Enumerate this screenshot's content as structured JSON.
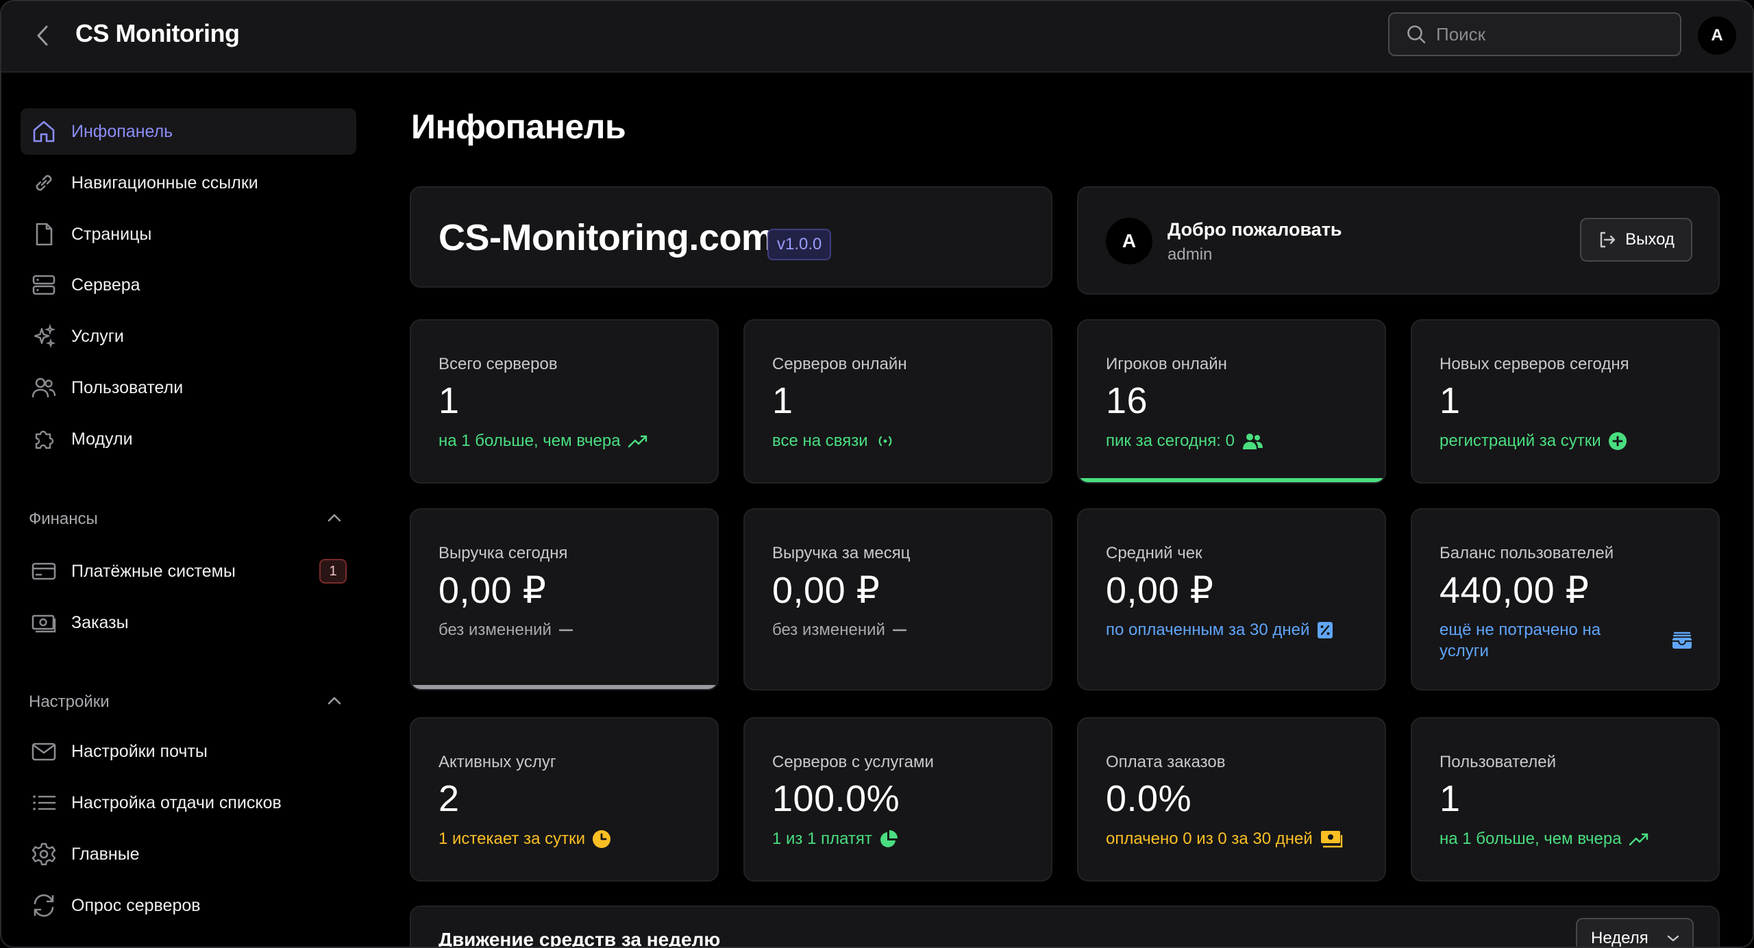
{
  "header": {
    "title": "CS Monitoring",
    "search_placeholder": "Поиск",
    "avatar": "A"
  },
  "sidebar": {
    "items": [
      {
        "label": "Инфопанель",
        "icon": "home-icon",
        "active": true
      },
      {
        "label": "Навигационные ссылки",
        "icon": "link-icon"
      },
      {
        "label": "Страницы",
        "icon": "file-icon"
      },
      {
        "label": "Сервера",
        "icon": "server-icon"
      },
      {
        "label": "Услуги",
        "icon": "sparkles-icon"
      },
      {
        "label": "Пользователи",
        "icon": "users-icon"
      },
      {
        "label": "Модули",
        "icon": "puzzle-icon"
      }
    ],
    "finance": {
      "title": "Финансы",
      "items": [
        {
          "label": "Платёжные системы",
          "icon": "credit-card-icon",
          "badge": "1"
        },
        {
          "label": "Заказы",
          "icon": "banknote-icon"
        }
      ]
    },
    "settings": {
      "title": "Настройки",
      "items": [
        {
          "label": "Настройки почты",
          "icon": "mail-icon"
        },
        {
          "label": "Настройка отдачи списков",
          "icon": "list-icon"
        },
        {
          "label": "Главные",
          "icon": "gear-icon"
        },
        {
          "label": "Опрос серверов",
          "icon": "refresh-icon"
        }
      ]
    }
  },
  "main": {
    "title": "Инфопанель",
    "brand": {
      "name": "CS-Monitoring.com",
      "version": "v1.0.0"
    },
    "welcome": {
      "avatar": "A",
      "title": "Добро пожаловать",
      "user": "admin",
      "logout_label": "Выход"
    },
    "stats": [
      {
        "label": "Всего серверов",
        "value": "1",
        "sub": "на 1 больше, чем вчера",
        "tone": "green",
        "icon": "trend-up-icon"
      },
      {
        "label": "Серверов онлайн",
        "value": "1",
        "sub": "все на связи",
        "tone": "green",
        "icon": "signal-icon"
      },
      {
        "label": "Игроков онлайн",
        "value": "16",
        "sub": "пик за сегодня: 0",
        "tone": "green",
        "icon": "users-icon",
        "progress": 1.0,
        "progress_color": "#4ade80"
      },
      {
        "label": "Новых серверов сегодня",
        "value": "1",
        "sub": "регистраций за сутки",
        "tone": "green",
        "icon": "plus-circle-icon"
      },
      {
        "label": "Выручка сегодня",
        "value": "0,00 ₽",
        "sub": "без изменений",
        "tone": "gray",
        "icon": "dash-icon",
        "progress": 1.0,
        "progress_color": "#9a9aa0"
      },
      {
        "label": "Выручка за месяц",
        "value": "0,00 ₽",
        "sub": "без изменений",
        "tone": "gray",
        "icon": "dash-icon"
      },
      {
        "label": "Средний чек",
        "value": "0,00 ₽",
        "sub": "по оплаченным за 30 дней",
        "tone": "blue",
        "icon": "receipt-percent-icon"
      },
      {
        "label": "Баланс пользователей",
        "value": "440,00 ₽",
        "sub": "ещё не потрачено на услуги",
        "tone": "blue",
        "icon": "wallet-icon"
      },
      {
        "label": "Активных услуг",
        "value": "2",
        "sub": "1 истекает за сутки",
        "tone": "orange",
        "icon": "clock-icon"
      },
      {
        "label": "Серверов с услугами",
        "value": "100.0%",
        "sub": "1 из 1 платят",
        "tone": "green",
        "icon": "pie-chart-icon"
      },
      {
        "label": "Оплата заказов",
        "value": "0.0%",
        "sub": "оплачено 0 из 0 за 30 дней",
        "tone": "orange",
        "icon": "cash-icon"
      },
      {
        "label": "Пользователей",
        "value": "1",
        "sub": "на 1 больше, чем вчера",
        "tone": "green",
        "icon": "trend-up-icon"
      }
    ],
    "flow": {
      "title": "Движение средств за неделю",
      "period": "Неделя"
    }
  },
  "colors": {
    "accent": "#8b8cf6",
    "green": "#4ade80",
    "blue": "#60a5fa",
    "orange": "#fbbf24",
    "card": "#161618"
  }
}
